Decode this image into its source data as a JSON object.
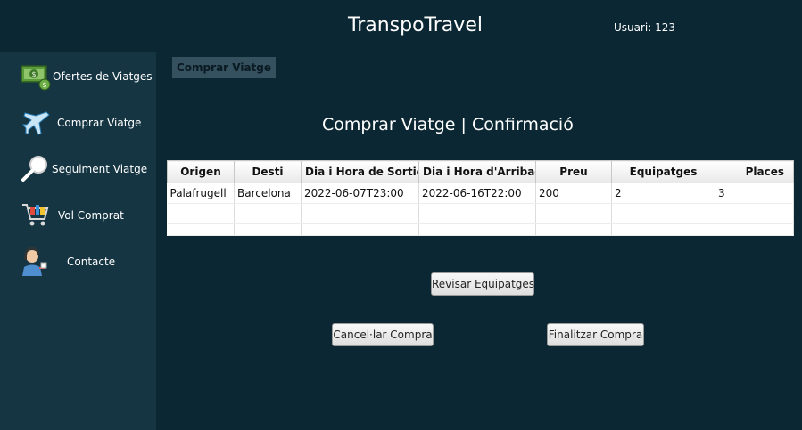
{
  "header": {
    "title": "TranspoTravel",
    "user": "Usuari: 123"
  },
  "sidebar": {
    "items": [
      {
        "label": "Ofertes de Viatges",
        "icon": "money-icon"
      },
      {
        "label": "Comprar Viatge",
        "icon": "airplane-icon"
      },
      {
        "label": "Seguiment Viatge",
        "icon": "magnifier-icon"
      },
      {
        "label": "Vol Comprat",
        "icon": "shopping-cart-icon"
      },
      {
        "label": "Contacte",
        "icon": "support-agent-icon"
      }
    ]
  },
  "main": {
    "breadcrumb": "Comprar Viatge",
    "title": "Comprar Viatge | Confirmació",
    "table": {
      "columns": [
        "Origen",
        "Desti",
        "Dia i Hora de Sortida",
        "Dia i Hora d'Arribada",
        "Preu",
        "Equipatges",
        "Places"
      ],
      "rows": [
        [
          "Palafrugell",
          "Barcelona",
          "2022-06-07T23:00",
          "2022-06-16T22:00",
          "200",
          "2",
          "3"
        ]
      ]
    },
    "buttons": {
      "review": "Revisar Equipatges",
      "cancel": "Cancel·lar Compra",
      "finish": "Finalitzar Compra"
    }
  },
  "colors": {
    "background": "#0b2733",
    "sidebar": "#153543",
    "breadcrumb_bg": "#35505e"
  }
}
